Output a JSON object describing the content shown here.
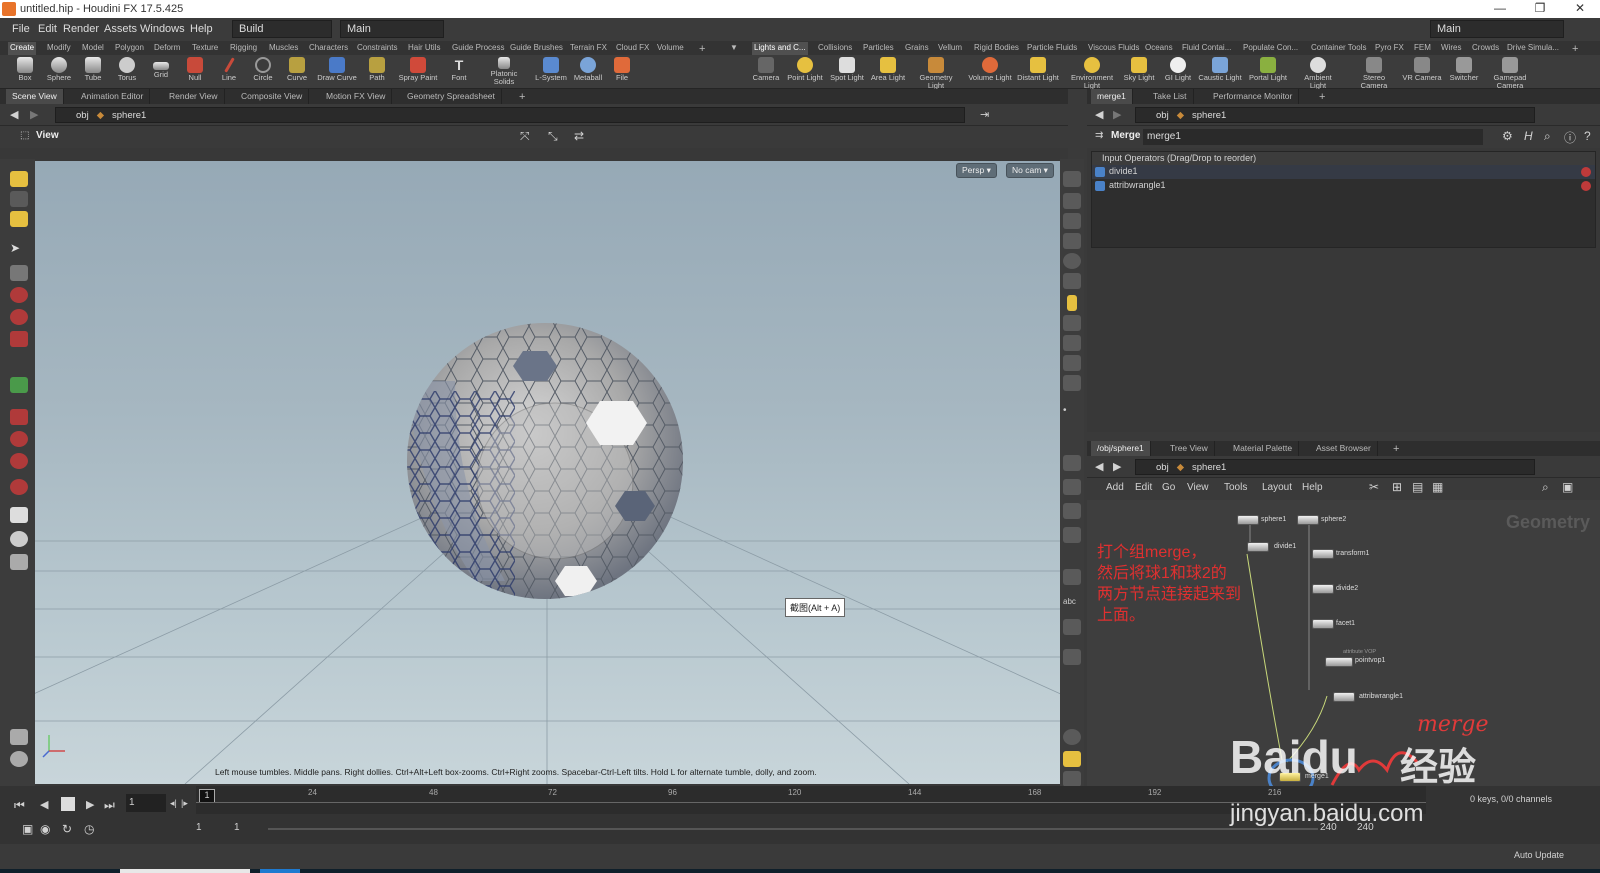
{
  "window": {
    "title": "untitled.hip - Houdini FX 17.5.425",
    "controls": [
      "—",
      "❐",
      "✕"
    ]
  },
  "menubar": {
    "items": [
      "File",
      "Edit",
      "Render",
      "Assets",
      "Windows",
      "Help"
    ],
    "desktop": "Build",
    "main": "Main",
    "right_main": "Main"
  },
  "shelf_tabs_left": [
    "Create",
    "Modify",
    "Model",
    "Polygon",
    "Deform",
    "Texture",
    "Rigging",
    "Muscles",
    "Characters",
    "Constraints",
    "Hair Utils",
    "Guide Process",
    "Guide Brushes",
    "Terrain FX",
    "Cloud FX",
    "Volume"
  ],
  "shelf_tabs_right": [
    "Lights and C...",
    "Collisions",
    "Particles",
    "Grains",
    "Vellum",
    "Rigid Bodies",
    "Particle Fluids",
    "Viscous Fluids",
    "Oceans",
    "Fluid Contai...",
    "Populate Con...",
    "Container Tools",
    "Pyro FX",
    "FEM",
    "Wires",
    "Crowds",
    "Drive Simula..."
  ],
  "create_tools": [
    "Box",
    "Sphere",
    "Tube",
    "Torus",
    "Grid",
    "Null",
    "Line",
    "Circle",
    "Curve",
    "Draw Curve",
    "Path",
    "Spray Paint",
    "Font",
    "Platonic Solids",
    "L-System",
    "Metaball",
    "File"
  ],
  "light_tools": [
    "Camera",
    "Point Light",
    "Spot Light",
    "Area Light",
    "Geometry Light",
    "Volume Light",
    "Distant Light",
    "Environment Light",
    "Sky Light",
    "GI Light",
    "Caustic Light",
    "Portal Light",
    "Ambient Light",
    "Stereo Camera",
    "VR Camera",
    "Switcher",
    "Gamepad Camera"
  ],
  "left_pane": {
    "tabs": [
      "Scene View",
      "Animation Editor",
      "Render View",
      "Composite View",
      "Motion FX View",
      "Geometry Spreadsheet"
    ],
    "path_obj": "obj",
    "path_node": "sphere1",
    "view_label": "View",
    "persp": "Persp ▾",
    "cam": "No cam ▾",
    "hint": "Left mouse tumbles. Middle pans. Right dollies. Ctrl+Alt+Left box-zooms. Ctrl+Right zooms. Spacebar-Ctrl-Left tilts. Hold L for alternate tumble, dolly, and zoom.",
    "tooltip": "截图(Alt + A)"
  },
  "param_pane": {
    "tabs": [
      "merge1",
      "Take List",
      "Performance Monitor"
    ],
    "path_obj": "obj",
    "path_node": "sphere1",
    "node_type": "Merge",
    "node_name": "merge1",
    "list_header": "Input Operators (Drag/Drop to reorder)",
    "inputs": [
      "divide1",
      "attribwrangle1"
    ]
  },
  "network_pane": {
    "tabs": [
      "/obj/sphere1",
      "Tree View",
      "Material Palette",
      "Asset Browser"
    ],
    "path_obj": "obj",
    "path_node": "sphere1",
    "menu": [
      "Add",
      "Edit",
      "Go",
      "View",
      "Tools",
      "Layout",
      "Help"
    ],
    "context": "Geometry",
    "note": [
      "打个组merge，",
      "然后将球1和球2的",
      "两方节点连接起来到",
      "上面。"
    ],
    "nodes": {
      "sphere1": "sphere1",
      "sphere2": "sphere2",
      "divide1": "divide1",
      "transform1": "transform1",
      "divide2": "divide2",
      "facet1": "facet1",
      "pointvop1": "pointvop1",
      "attribwrangle1": "attribwrangle1",
      "merge1": "merge1"
    },
    "merge_sublabel": "attribute VOP",
    "scribble": "merge"
  },
  "timeline": {
    "frame": "1",
    "ticks": [
      "1",
      "24",
      "48",
      "72",
      "96",
      "120",
      "144",
      "168",
      "192",
      "216"
    ],
    "start": "1",
    "start2": "1",
    "end": "240",
    "end2": "240",
    "keys": "0 keys, 0/0 channels",
    "auto": "Auto Update"
  },
  "watermark": {
    "brand": "Baidu",
    "cn": "经验",
    "url": "jingyan.baidu.com"
  }
}
